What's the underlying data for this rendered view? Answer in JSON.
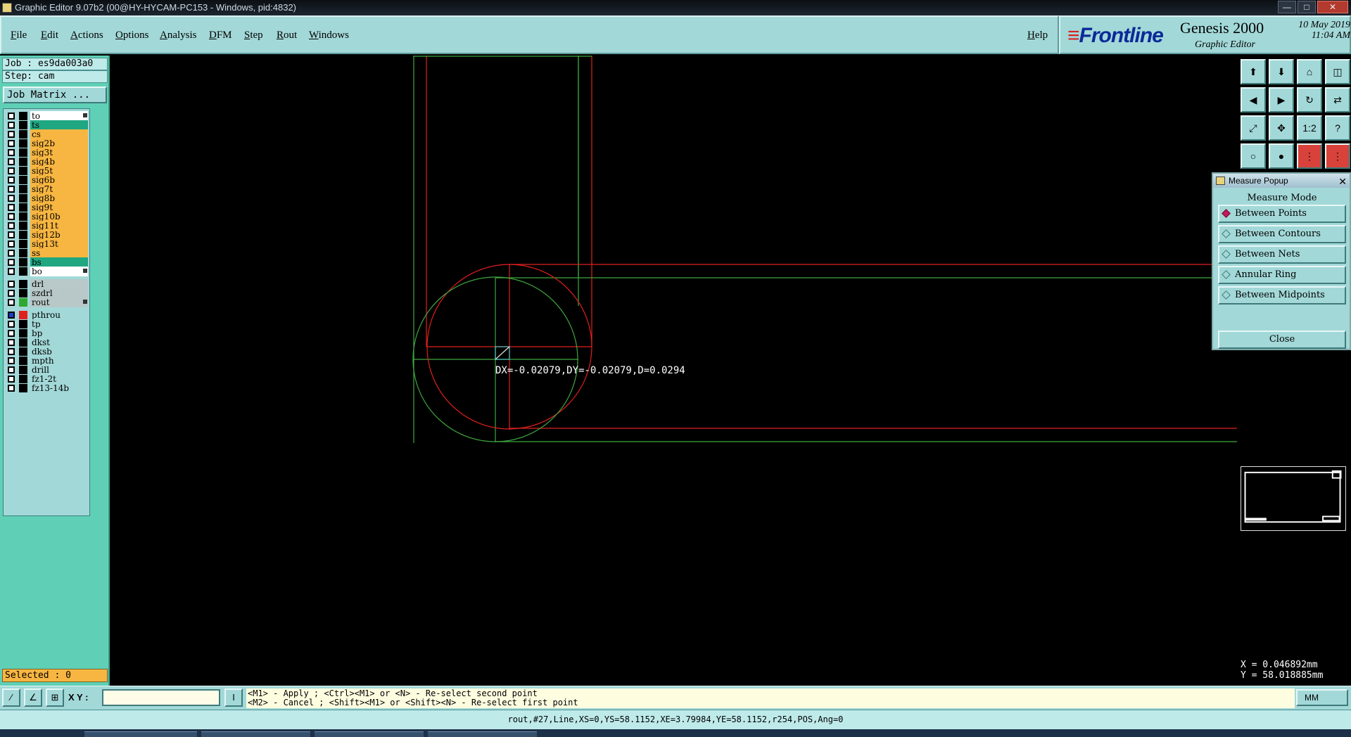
{
  "window": {
    "title": "Graphic Editor 9.07b2 (00@HY-HYCAM-PC153 - Windows, pid:4832)",
    "controls": [
      "—",
      "□",
      "✕"
    ]
  },
  "menu": {
    "items": [
      "File",
      "Edit",
      "Actions",
      "Options",
      "Analysis",
      "DFM",
      "Step",
      "Rout",
      "Windows"
    ],
    "help": "Help"
  },
  "brand": {
    "logo_text": "Frontline",
    "product": "Genesis 2000",
    "subtitle": "Graphic Editor",
    "date": "10 May 2019",
    "time": "11:04 AM"
  },
  "job": {
    "job_label": "Job : es9da003a0",
    "step_label": "Step: cam",
    "job_matrix": "Job Matrix ..."
  },
  "layers": [
    {
      "name": "to",
      "color": "#ffffff",
      "swatch": "#000000",
      "marker": true
    },
    {
      "name": "ts",
      "color": "#1fa782",
      "swatch": "#000000"
    },
    {
      "name": "cs",
      "color": "#f7b641",
      "swatch": "#000000"
    },
    {
      "name": "sig2b",
      "color": "#f7b641",
      "swatch": "#000000"
    },
    {
      "name": "sig3t",
      "color": "#f7b641",
      "swatch": "#000000"
    },
    {
      "name": "sig4b",
      "color": "#f7b641",
      "swatch": "#000000"
    },
    {
      "name": "sig5t",
      "color": "#f7b641",
      "swatch": "#000000"
    },
    {
      "name": "sig6b",
      "color": "#f7b641",
      "swatch": "#000000"
    },
    {
      "name": "sig7t",
      "color": "#f7b641",
      "swatch": "#000000"
    },
    {
      "name": "sig8b",
      "color": "#f7b641",
      "swatch": "#000000"
    },
    {
      "name": "sig9t",
      "color": "#f7b641",
      "swatch": "#000000"
    },
    {
      "name": "sig10b",
      "color": "#f7b641",
      "swatch": "#000000"
    },
    {
      "name": "sig11t",
      "color": "#f7b641",
      "swatch": "#000000"
    },
    {
      "name": "sig12b",
      "color": "#f7b641",
      "swatch": "#000000"
    },
    {
      "name": "sig13t",
      "color": "#f7b641",
      "swatch": "#000000"
    },
    {
      "name": "ss",
      "color": "#f7b641",
      "swatch": "#000000"
    },
    {
      "name": "bs",
      "color": "#1fa782",
      "swatch": "#000000"
    },
    {
      "name": "bo",
      "color": "#ffffff",
      "swatch": "#000000",
      "marker": true
    },
    {
      "name": "drl",
      "color": "#b8c8c8",
      "swatch": "#000000",
      "gap": true
    },
    {
      "name": "szdrl",
      "color": "#b8c8c8",
      "swatch": "#000000"
    },
    {
      "name": "rout",
      "color": "#b8c8c8",
      "swatch": "#2fa82f",
      "marker": true
    },
    {
      "name": "pthrou",
      "color": "#a3d8d8",
      "swatch": "#e0201d",
      "gap": true,
      "checked": true
    },
    {
      "name": "tp",
      "color": "#a3d8d8",
      "swatch": "#000000"
    },
    {
      "name": "bp",
      "color": "#a3d8d8",
      "swatch": "#000000"
    },
    {
      "name": "dkst",
      "color": "#a3d8d8",
      "swatch": "#000000"
    },
    {
      "name": "dksb",
      "color": "#a3d8d8",
      "swatch": "#000000"
    },
    {
      "name": "mpth",
      "color": "#a3d8d8",
      "swatch": "#000000"
    },
    {
      "name": "drill",
      "color": "#a3d8d8",
      "swatch": "#000000"
    },
    {
      "name": "fz1-2t",
      "color": "#a3d8d8",
      "swatch": "#000000"
    },
    {
      "name": "fz13-14b",
      "color": "#a3d8d8",
      "swatch": "#000000"
    }
  ],
  "selected": "Selected : 0",
  "canvas": {
    "measure_text": "DX=-0.02079,DY=-0.02079,D=0.0294",
    "colors": {
      "red": "#e0201d",
      "green": "#3fa83f",
      "cyan": "#4fc6c6"
    }
  },
  "toolbar": {
    "icons": [
      "layer-up-icon",
      "layer-down-icon",
      "home-icon",
      "split-window-icon",
      "move-left-icon",
      "move-right-icon",
      "rotate-icon",
      "mirror-icon",
      "fit-icon",
      "zoom-fit-icon",
      "ratio-icon",
      "help-icon",
      "snap-icon",
      "measure-icon",
      "graphic-red-icon",
      "graphic-red2-icon"
    ],
    "ratio_label": "1:2",
    "help_label": "?"
  },
  "measure_popup": {
    "title": "Measure Popup",
    "mode_heading": "Measure Mode",
    "options": [
      {
        "label": "Between Points",
        "selected": true
      },
      {
        "label": "Between Contours",
        "selected": false
      },
      {
        "label": "Between Nets",
        "selected": false
      },
      {
        "label": "Annular Ring",
        "selected": false
      },
      {
        "label": "Between Midpoints",
        "selected": false
      }
    ],
    "close": "Close"
  },
  "coords": {
    "x": "X = 0.046892mm",
    "y": "Y = 58.018885mm"
  },
  "bottom": {
    "xy_label": "X Y :",
    "xy_value": "",
    "hint_line1": "<M1> - Apply  ; <Ctrl><M1> or <N> - Re-select second point",
    "hint_line2": "<M2> - Cancel ; <Shift><M1> or <Shift><N> - Re-select first point",
    "units": "MM",
    "status": "rout,#27,Line,XS=0,YS=58.1152,XE=3.79984,YE=58.1152,r254,POS,Ang=0"
  }
}
